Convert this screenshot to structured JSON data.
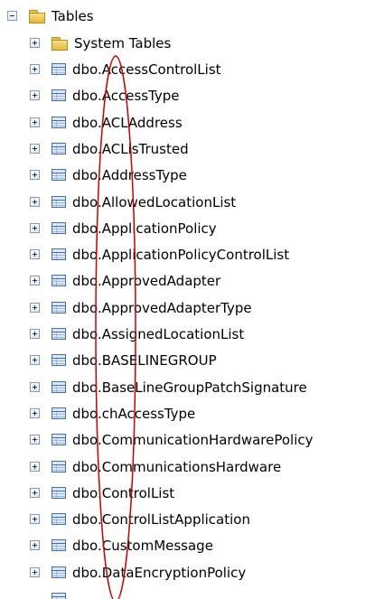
{
  "tree": {
    "root": {
      "label": "Tables",
      "expander": "minus",
      "icon": "folder-icon"
    },
    "system_folder": {
      "label": "System Tables",
      "expander": "plus",
      "icon": "folder-icon"
    },
    "tables": [
      {
        "label": "dbo.AccessControlList"
      },
      {
        "label": "dbo.AccessType"
      },
      {
        "label": "dbo.ACLAddress"
      },
      {
        "label": "dbo.ACLisTrusted"
      },
      {
        "label": "dbo.AddressType"
      },
      {
        "label": "dbo.AllowedLocationList"
      },
      {
        "label": "dbo.ApplicationPolicy"
      },
      {
        "label": "dbo.ApplicationPolicyControlList"
      },
      {
        "label": "dbo.ApprovedAdapter"
      },
      {
        "label": "dbo.ApprovedAdapterType"
      },
      {
        "label": "dbo.AssignedLocationList"
      },
      {
        "label": "dbo.BASELINEGROUP"
      },
      {
        "label": "dbo.BaseLineGroupPatchSignature"
      },
      {
        "label": "dbo.chAccessType"
      },
      {
        "label": "dbo.CommunicationHardwarePolicy"
      },
      {
        "label": "dbo.CommunicationsHardware"
      },
      {
        "label": "dbo.ControlList"
      },
      {
        "label": "dbo.ControlListApplication"
      },
      {
        "label": "dbo.CustomMessage"
      },
      {
        "label": "dbo.DataEncryptionPolicy"
      }
    ],
    "table_icon": "table-icon",
    "row_expander": "plus"
  },
  "annotation": {
    "shape": "ellipse",
    "color": "#cc0000"
  }
}
